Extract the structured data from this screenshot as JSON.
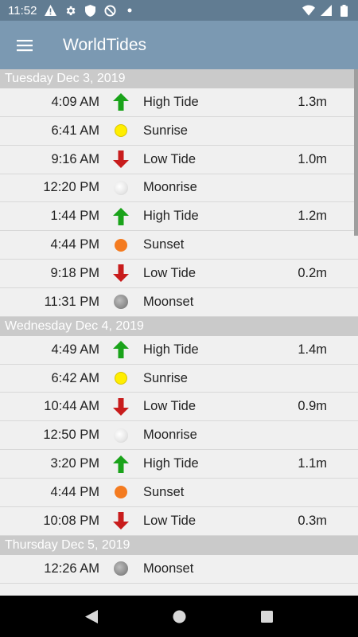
{
  "status_bar": {
    "time": "11:52",
    "icons": [
      "alert-icon",
      "gear-icon",
      "shield-icon",
      "data-saver-icon",
      "dot-icon",
      "wifi-icon",
      "signal-icon",
      "battery-icon"
    ]
  },
  "app_bar": {
    "title": "WorldTides",
    "menu_icon": "hamburger-menu-icon",
    "color": "#7b99b2"
  },
  "days": [
    {
      "label": "Tuesday Dec 3, 2019",
      "events": [
        {
          "time": "4:09 AM",
          "icon": "high-tide-icon",
          "event": "High Tide",
          "height": "1.3m"
        },
        {
          "time": "6:41 AM",
          "icon": "sunrise-icon",
          "event": "Sunrise",
          "height": ""
        },
        {
          "time": "9:16 AM",
          "icon": "low-tide-icon",
          "event": "Low Tide",
          "height": "1.0m"
        },
        {
          "time": "12:20 PM",
          "icon": "moonrise-icon",
          "event": "Moonrise",
          "height": ""
        },
        {
          "time": "1:44 PM",
          "icon": "high-tide-icon",
          "event": "High Tide",
          "height": "1.2m"
        },
        {
          "time": "4:44 PM",
          "icon": "sunset-icon",
          "event": "Sunset",
          "height": ""
        },
        {
          "time": "9:18 PM",
          "icon": "low-tide-icon",
          "event": "Low Tide",
          "height": "0.2m"
        },
        {
          "time": "11:31 PM",
          "icon": "moonset-icon",
          "event": "Moonset",
          "height": ""
        }
      ]
    },
    {
      "label": "Wednesday Dec 4, 2019",
      "events": [
        {
          "time": "4:49 AM",
          "icon": "high-tide-icon",
          "event": "High Tide",
          "height": "1.4m"
        },
        {
          "time": "6:42 AM",
          "icon": "sunrise-icon",
          "event": "Sunrise",
          "height": ""
        },
        {
          "time": "10:44 AM",
          "icon": "low-tide-icon",
          "event": "Low Tide",
          "height": "0.9m"
        },
        {
          "time": "12:50 PM",
          "icon": "moonrise-icon",
          "event": "Moonrise",
          "height": ""
        },
        {
          "time": "3:20 PM",
          "icon": "high-tide-icon",
          "event": "High Tide",
          "height": "1.1m"
        },
        {
          "time": "4:44 PM",
          "icon": "sunset-icon",
          "event": "Sunset",
          "height": ""
        },
        {
          "time": "10:08 PM",
          "icon": "low-tide-icon",
          "event": "Low Tide",
          "height": "0.3m"
        }
      ]
    },
    {
      "label": "Thursday Dec 5, 2019",
      "events": [
        {
          "time": "12:26 AM",
          "icon": "moonset-icon",
          "event": "Moonset",
          "height": ""
        }
      ]
    }
  ],
  "colors": {
    "high_tide": "#1aa31a",
    "low_tide": "#c81c1c",
    "sunrise": "#ffee00",
    "sunset": "#f47b20",
    "day_header": "#cacaca"
  },
  "nav_bar": {
    "back": "back-icon",
    "home": "home-icon",
    "recents": "recents-icon"
  }
}
